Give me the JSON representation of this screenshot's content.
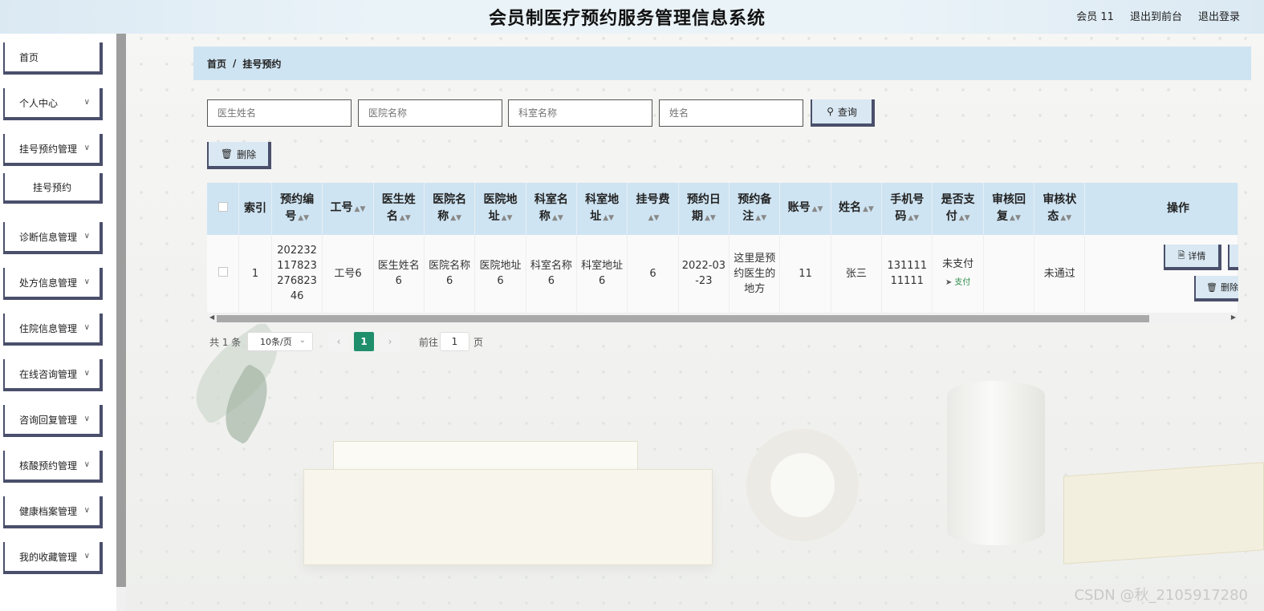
{
  "header": {
    "title": "会员制医疗预约服务管理信息系统",
    "user": "会员 11",
    "back_front": "退出到前台",
    "logout": "退出登录"
  },
  "sidebar": {
    "items": [
      {
        "label": "首页",
        "arrow": false
      },
      {
        "label": "个人中心",
        "arrow": true
      },
      {
        "label": "挂号预约管理",
        "arrow": true
      },
      {
        "label": "挂号预约",
        "arrow": false,
        "sub": true
      },
      {
        "label": "诊断信息管理",
        "arrow": true
      },
      {
        "label": "处方信息管理",
        "arrow": true
      },
      {
        "label": "住院信息管理",
        "arrow": true
      },
      {
        "label": "在线咨询管理",
        "arrow": true
      },
      {
        "label": "咨询回复管理",
        "arrow": true
      },
      {
        "label": "核酸预约管理",
        "arrow": true
      },
      {
        "label": "健康档案管理",
        "arrow": true
      },
      {
        "label": "我的收藏管理",
        "arrow": true
      }
    ]
  },
  "breadcrumb": {
    "home": "首页",
    "sep": "/",
    "current": "挂号预约"
  },
  "search": {
    "doctor_placeholder": "医生姓名",
    "hospital_placeholder": "医院名称",
    "dept_placeholder": "科室名称",
    "name_placeholder": "姓名",
    "query_label": "查询",
    "delete_label": "删除"
  },
  "table": {
    "columns": [
      "索引",
      "预约编号",
      "工号",
      "医生姓名",
      "医院名称",
      "医院地址",
      "科室名称",
      "科室地址",
      "挂号费",
      "预约日期",
      "预约备注",
      "账号",
      "姓名",
      "手机号码",
      "是否支付",
      "审核回复",
      "审核状态",
      "操作"
    ],
    "rows": [
      {
        "index": "1",
        "booking_no": "20223211782327682346",
        "job_no": "工号6",
        "doctor": "医生姓名6",
        "hospital": "医院名称6",
        "hospital_addr": "医院地址6",
        "dept": "科室名称6",
        "dept_addr": "科室地址6",
        "fee": "6",
        "date": "2022-03-23",
        "remark": "这里是预约医生的地方",
        "account": "11",
        "name": "张三",
        "phone": "13111111111",
        "paid": "未支付",
        "pay_link": "支付",
        "reply": "",
        "status": "未通过",
        "detail_label": "详情",
        "delete_label": "删除"
      }
    ]
  },
  "pagination": {
    "total": "共 1 条",
    "page_size": "10条/页",
    "current_page": "1",
    "goto_label": "前往",
    "goto_value": "1",
    "page_suffix": "页"
  },
  "watermark": "CSDN @秋_2105917280",
  "colors": {
    "accent_bar": "#cfe4f2",
    "border_dark": "#4a4f6b",
    "pager_active": "#1f8f6b"
  }
}
